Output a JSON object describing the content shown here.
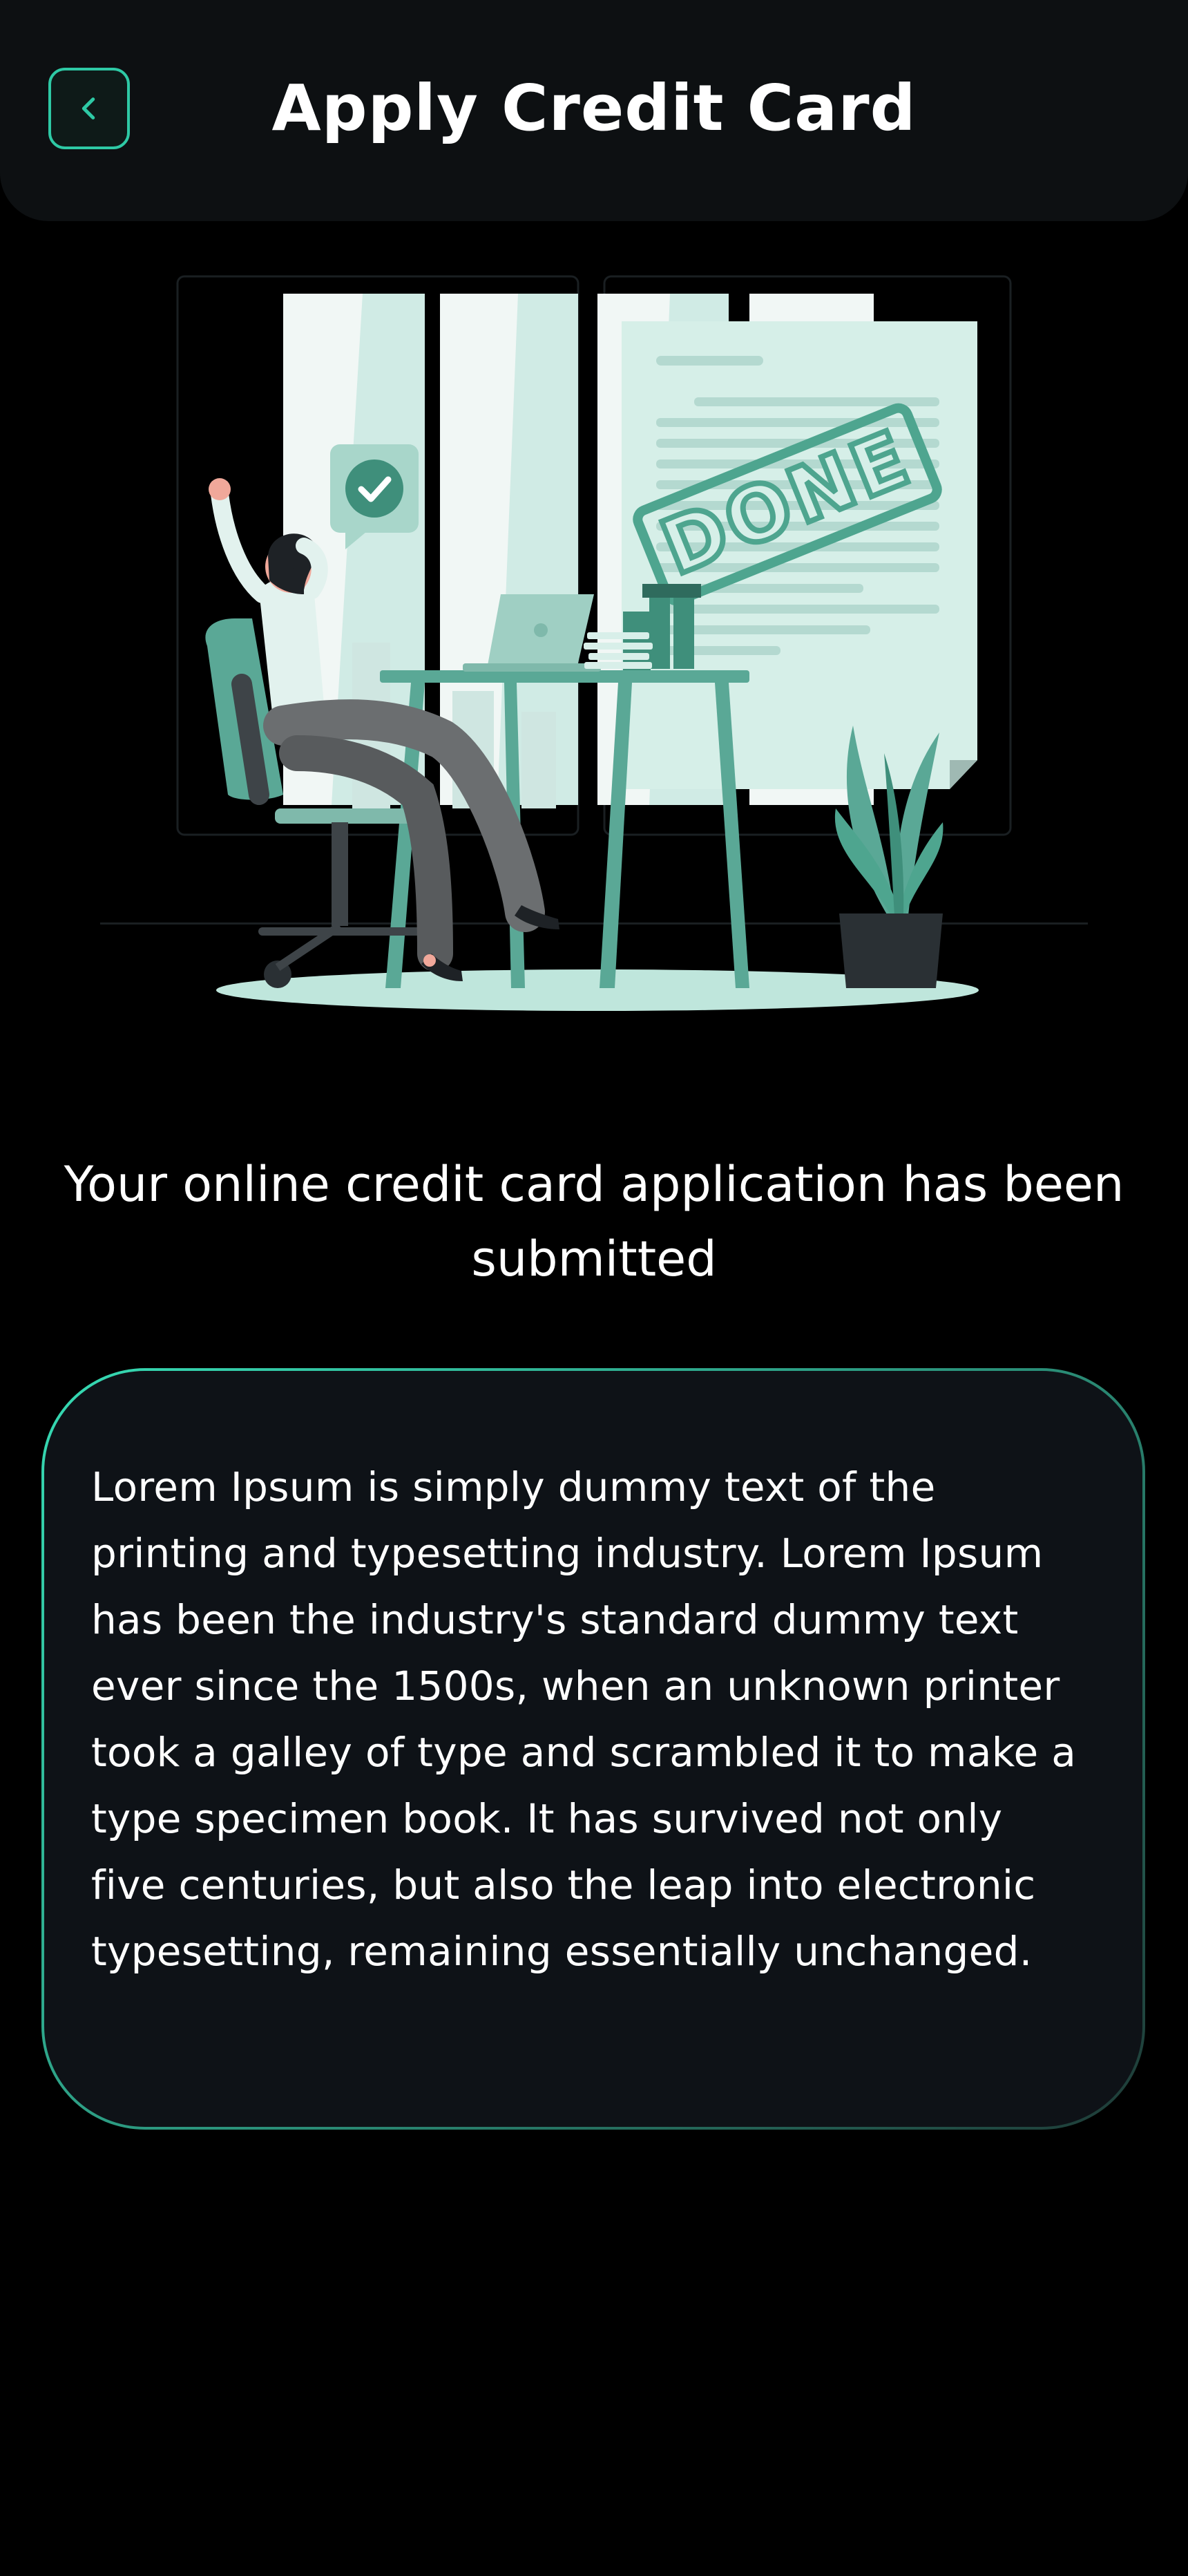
{
  "header": {
    "title": "Apply Credit Card",
    "back_icon": "chevron-left-icon"
  },
  "illustration": {
    "stamp_text": "DONE",
    "description_icon": "check-icon"
  },
  "main": {
    "headline": "Your online credit card application has been submitted",
    "body": "Lorem Ipsum is simply dummy text of the printing and typesetting industry. Lorem Ipsum has been the industry's standard dummy text ever since the 1500s, when an unknown printer took a galley of type and scrambled it to make a type specimen book. It has survived not only five centuries, but also the leap into electronic typesetting, remaining essentially unchanged."
  },
  "colors": {
    "accent": "#2ec9a5",
    "background": "#000000",
    "header_bg": "#0d1012",
    "card_bg": "#0e1217",
    "illustration_teal": "#5aa896",
    "illustration_light": "#d8f0ea"
  }
}
